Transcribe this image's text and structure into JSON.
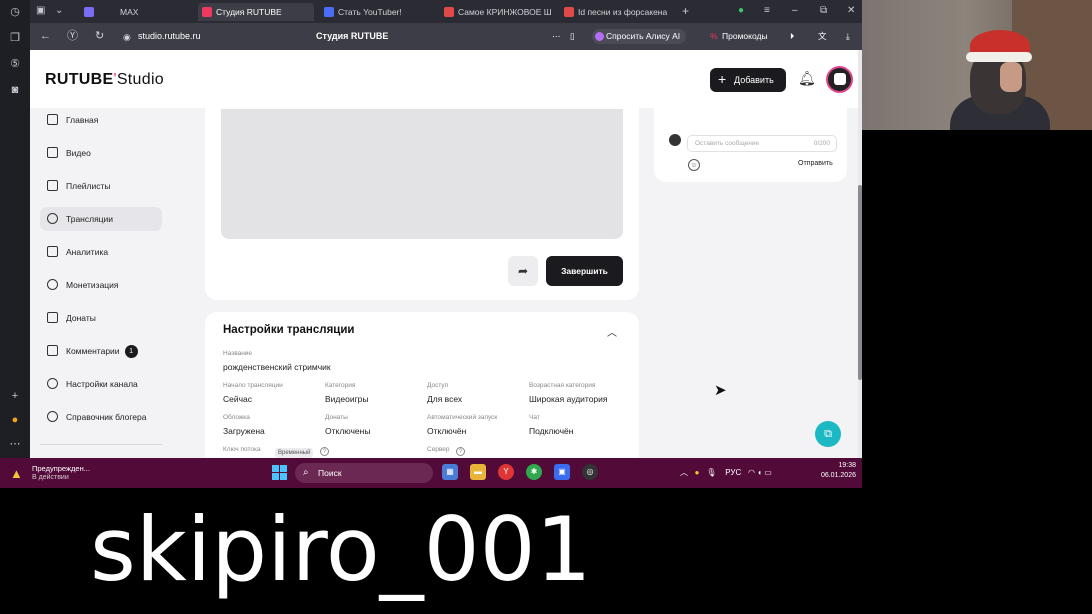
{
  "browser": {
    "tabs": [
      {
        "label": "MAX",
        "favicon_color": "#7b6cf6"
      },
      {
        "label": "Студия RUTUBE",
        "favicon_color": "#ee3860"
      },
      {
        "label": "Стать YouTuber! ",
        "favicon_color": "#4a6cf7"
      },
      {
        "label": "Самое КРИНЖОВОЕ Ш",
        "favicon_color": "#e24a4a"
      },
      {
        "label": "Id песни из форсакена",
        "favicon_color": "#e24a4a"
      }
    ],
    "new_tab": "+",
    "url": "studio.rutube.ru",
    "page_title": "Студия RUTUBE",
    "alice_button": "Спросить Алису AI",
    "promo_button": "Промокоды"
  },
  "header": {
    "logo_main": "RUTUBE",
    "logo_dot": "'",
    "logo_sub": "Studio",
    "add_button": "Добавить"
  },
  "sidebar": {
    "items": [
      {
        "label": "Главная",
        "active": false
      },
      {
        "label": "Видео",
        "active": false
      },
      {
        "label": "Плейлисты",
        "active": false
      },
      {
        "label": "Трансляции",
        "active": true
      },
      {
        "label": "Аналитика",
        "active": false
      },
      {
        "label": "Монетизация",
        "active": false
      },
      {
        "label": "Донаты",
        "active": false
      },
      {
        "label": "Комментарии",
        "active": false,
        "badge": "1"
      },
      {
        "label": "Настройки канала",
        "active": false
      },
      {
        "label": "Справочник блогера",
        "active": false
      }
    ]
  },
  "player": {
    "finish_button": "Завершить"
  },
  "settings": {
    "title": "Настройки трансляции",
    "name_label": "Название",
    "name_value": "рожденственский стримчик",
    "fields": [
      {
        "label": "Начало трансляции",
        "value": "Сейчас"
      },
      {
        "label": "Категория",
        "value": "Видеоигры"
      },
      {
        "label": "Доступ",
        "value": "Для всех"
      },
      {
        "label": "Возрастная категория",
        "value": "Широкая аудитория"
      },
      {
        "label": "Обложка",
        "value": "Загружена"
      },
      {
        "label": "Донаты",
        "value": "Отключены"
      },
      {
        "label": "Автоматический запуск",
        "value": "Отключён"
      },
      {
        "label": "Чат",
        "value": "Подключён"
      }
    ],
    "stream_key_label": "Ключ потока",
    "stream_key_badge": "Временный",
    "server_label": "Сервер"
  },
  "chat": {
    "placeholder": "Оставить сообщение",
    "counter": "0/200",
    "send_button": "Отправить"
  },
  "taskbar": {
    "notif_title": "Предупрежден...",
    "notif_sub": "В действии",
    "search_placeholder": "Поиск",
    "language": "РУС",
    "time": "19:38",
    "date": "06.01.2026",
    "accent": "#520a38"
  },
  "overlay": {
    "username": "skipiro_001"
  }
}
